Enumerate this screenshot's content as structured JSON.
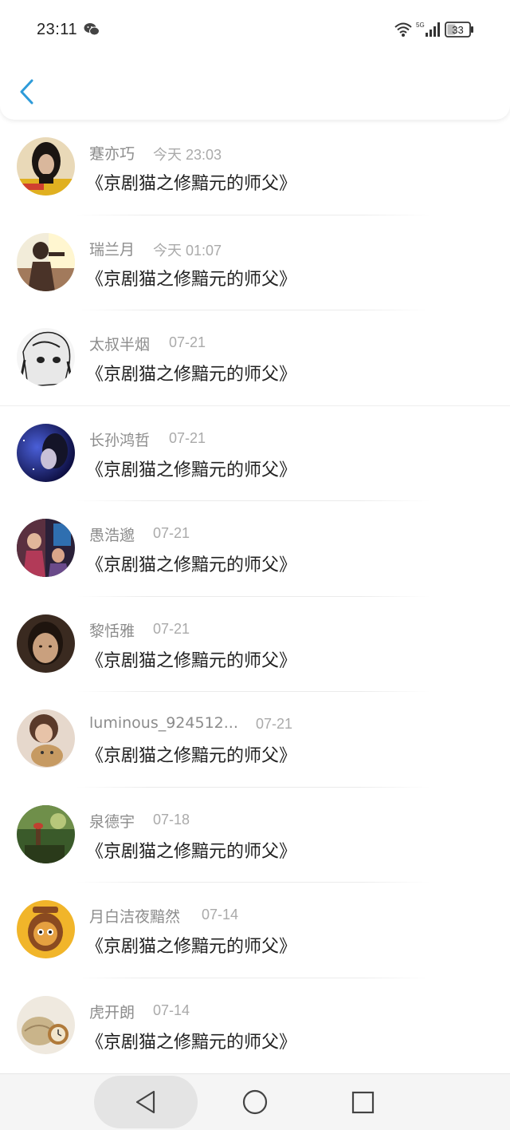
{
  "status_bar": {
    "time": "23:11",
    "network": "5G",
    "battery": "33"
  },
  "header": {
    "back_icon": "chevron-left-icon",
    "accent_color": "#2e9bd9"
  },
  "comments": [
    {
      "name": "蹇亦巧",
      "time": "今天 23:03",
      "title": "《京剧猫之修黯元的师父》"
    },
    {
      "name": "瑞兰月",
      "time": "今天 01:07",
      "title": "《京剧猫之修黯元的师父》"
    },
    {
      "name": "太叔半烟",
      "time": "07-21",
      "title": "《京剧猫之修黯元的师父》"
    },
    {
      "name": "长孙鸿哲",
      "time": "07-21",
      "title": "《京剧猫之修黯元的师父》"
    },
    {
      "name": "愚浩邈",
      "time": "07-21",
      "title": "《京剧猫之修黯元的师父》"
    },
    {
      "name": "黎恬雅",
      "time": "07-21",
      "title": "《京剧猫之修黯元的师父》"
    },
    {
      "name": "luminous_924512...",
      "time": "07-21",
      "title": "《京剧猫之修黯元的师父》"
    },
    {
      "name": "泉德宇",
      "time": "07-18",
      "title": "《京剧猫之修黯元的师父》"
    },
    {
      "name": "月白洁夜黯然",
      "time": "07-14",
      "title": "《京剧猫之修黯元的师父》"
    },
    {
      "name": "虎开朗",
      "time": "07-14",
      "title": "《京剧猫之修黯元的师父》"
    }
  ],
  "nav_bar": {
    "back": "triangle-back-icon",
    "home": "circle-home-icon",
    "recent": "square-recents-icon"
  }
}
